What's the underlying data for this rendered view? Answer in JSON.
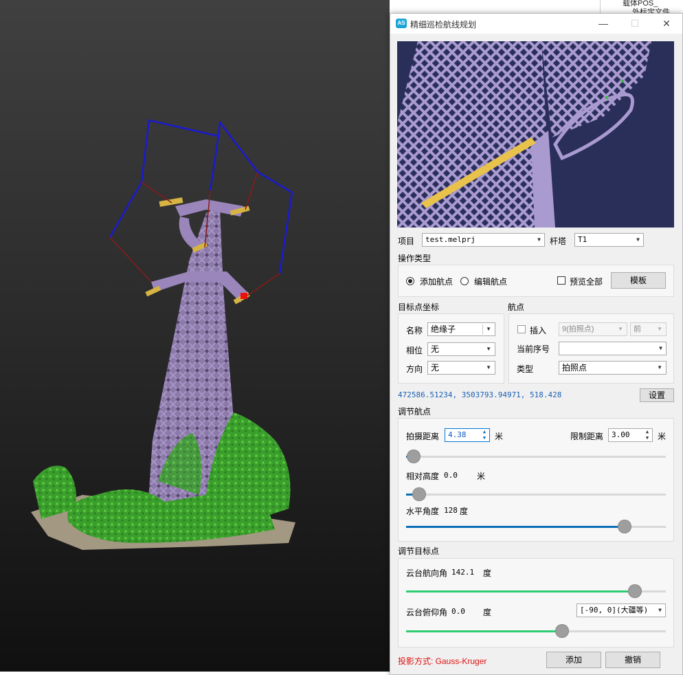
{
  "dialog": {
    "app_icon": "AS",
    "title": "精细巡检航线规划",
    "minimize_icon": "minimize-icon",
    "maximize_icon": "maximize-icon",
    "close_icon": "close-icon"
  },
  "background_tree": {
    "item1": "载体POS_",
    "item2": "外标定文件"
  },
  "project": {
    "label": "项目",
    "value": "test.melprj",
    "tower_label": "杆塔",
    "tower_value": "T1"
  },
  "operation": {
    "header": "操作类型",
    "add_label": "添加航点",
    "edit_label": "编辑航点",
    "selected": "添加航点",
    "preview_all_label": "预览全部",
    "template_button": "模板"
  },
  "target": {
    "header": "目标点坐标",
    "name_label": "名称",
    "name_value": "绝缘子",
    "phase_label": "相位",
    "phase_value": "无",
    "direction_label": "方向",
    "direction_value": "无"
  },
  "waypoint": {
    "header": "航点",
    "insert_label": "插入",
    "insert_value": "9(拍照点)",
    "position_value": "前",
    "current_index_label": "当前序号",
    "current_index_value": "",
    "type_label": "类型",
    "type_value": "拍照点"
  },
  "coords": {
    "text": "472586.51234, 3503793.94971, 518.428",
    "settings_button": "设置"
  },
  "adjust_waypoint": {
    "header": "调节航点",
    "distance_label": "拍摄距离",
    "distance_value": "4.38",
    "distance_unit": "米",
    "limit_label": "限制距离",
    "limit_value": "3.00",
    "limit_unit": "米",
    "distance_slider": 0.03,
    "rel_height_label": "相对高度",
    "rel_height_value": "0.0",
    "rel_height_unit": "米",
    "rel_height_slider": 0.05,
    "h_angle_label": "水平角度",
    "h_angle_value": "128",
    "h_angle_unit": "度",
    "h_angle_slider": 0.84,
    "slider_color": "#0a6fb8"
  },
  "adjust_target": {
    "header": "调节目标点",
    "yaw_label": "云台航向角",
    "yaw_value": "142.1",
    "yaw_unit": "度",
    "yaw_slider": 0.88,
    "pitch_label": "云台俯仰角",
    "pitch_value": "0.0",
    "pitch_unit": "度",
    "pitch_range": "[-90, 0](大疆等)",
    "pitch_slider": 0.6,
    "slider_color": "#2ecc71"
  },
  "footer": {
    "projection_label": "投影方式: Gauss-Kruger",
    "projection_color": "#e01010",
    "add_button": "添加",
    "cancel_button": "撤销"
  }
}
